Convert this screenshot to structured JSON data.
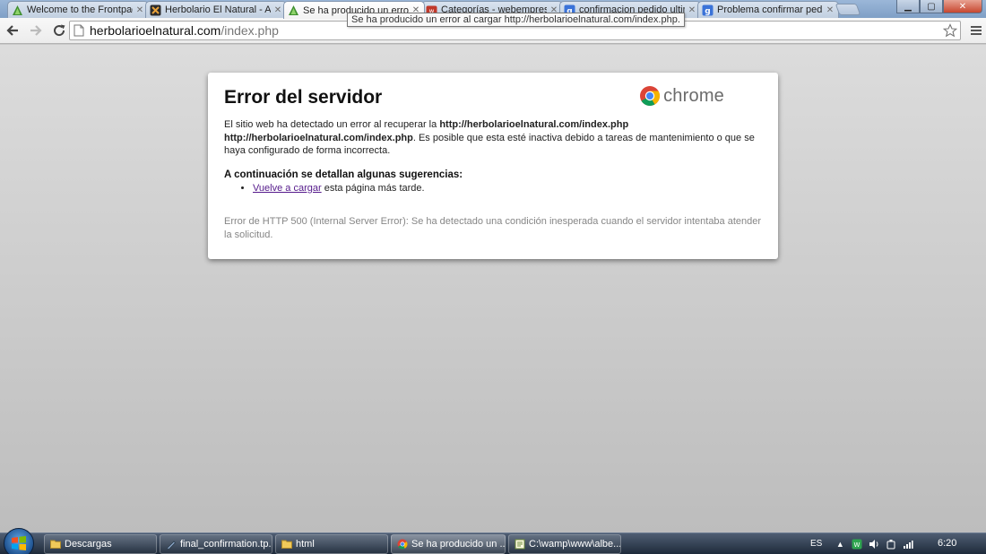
{
  "tabs": [
    {
      "title": "Welcome to the Frontpage",
      "icon": "joomla-triangle-icon",
      "active": false
    },
    {
      "title": "Herbolario El Natural - Adm",
      "icon": "joomla-admin-icon",
      "active": false
    },
    {
      "title": "Se ha producido un error a",
      "icon": "joomla-triangle-icon",
      "active": true
    },
    {
      "title": "Categorías - webempresa",
      "icon": "forum-icon",
      "active": false
    },
    {
      "title": "confirmacion pedido ultim",
      "icon": "google-icon",
      "active": false
    },
    {
      "title": "Problema confirmar pedido",
      "icon": "google-icon",
      "active": false
    }
  ],
  "tooltip": "Se ha producido un error al cargar http://herbolarioelnatural.com/index.php.",
  "address": {
    "host": "herbolarioelnatural.com",
    "path": "/index.php"
  },
  "error": {
    "title": "Error del servidor",
    "brand": "chrome",
    "body_pre": "El sitio web ha detectado un error al recuperar la ",
    "url_bold_1": "http://herbolarioelnatural.com/index.php",
    "url_bold_2": "http://herbolarioelnatural.com/index.php",
    "body_post": ". Es posible que esta esté inactiva debido a tareas de mantenimiento o que se haya configurado de forma incorrecta.",
    "suggestions_heading": "A continuación se detallan algunas sugerencias:",
    "suggestion_link": "Vuelve a cargar",
    "suggestion_rest": " esta página más tarde.",
    "detail": "Error de HTTP 500 (Internal Server Error): Se ha detectado una condición inesperada cuando el servidor intentaba atender la solicitud."
  },
  "taskbar": {
    "items": [
      {
        "label": "Descargas",
        "icon": "folder-icon"
      },
      {
        "label": "final_confirmation.tp...",
        "icon": "editor-icon"
      },
      {
        "label": "html",
        "icon": "folder-icon"
      },
      {
        "label": "Se ha producido un ...",
        "icon": "chrome-icon"
      },
      {
        "label": "C:\\wamp\\www\\albe...",
        "icon": "notepad-icon"
      }
    ],
    "language": "ES",
    "clock": "6:20"
  },
  "colors": {
    "link": "#551a8b",
    "detail_text": "#868686",
    "card_bg": "#ffffff"
  }
}
